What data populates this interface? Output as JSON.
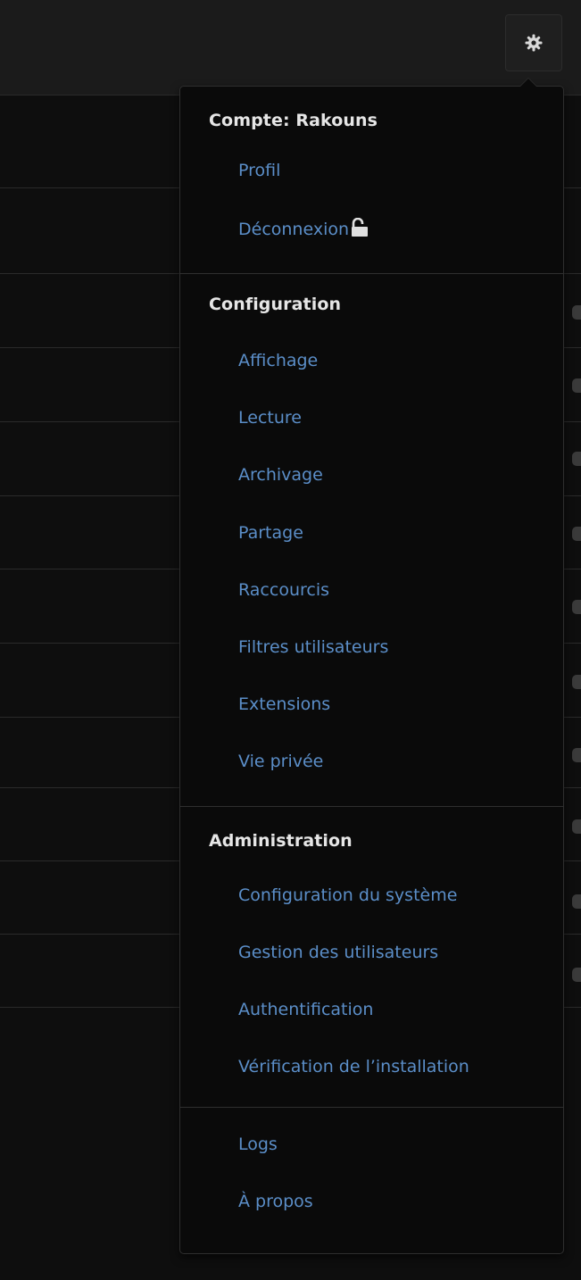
{
  "header": {
    "settings_icon": "gear-icon"
  },
  "menu": {
    "account": {
      "heading": "Compte: Rakouns",
      "items": [
        "Profil",
        "Déconnexion"
      ],
      "logout_icon": "unlock-icon"
    },
    "configuration": {
      "heading": "Configuration",
      "items": [
        "Affichage",
        "Lecture",
        "Archivage",
        "Partage",
        "Raccourcis",
        "Filtres utilisateurs",
        "Extensions",
        "Vie privée"
      ]
    },
    "administration": {
      "heading": "Administration",
      "items": [
        "Configuration du système",
        "Gestion des utilisateurs",
        "Authentification",
        "Vérification de l’installation"
      ]
    },
    "other": {
      "items": [
        "Logs",
        "À propos"
      ]
    }
  },
  "colors": {
    "background": "#0e0e0e",
    "menu_background": "#0a0a0a",
    "heading": "#e6e6e6",
    "link": "#5b8ec8"
  }
}
